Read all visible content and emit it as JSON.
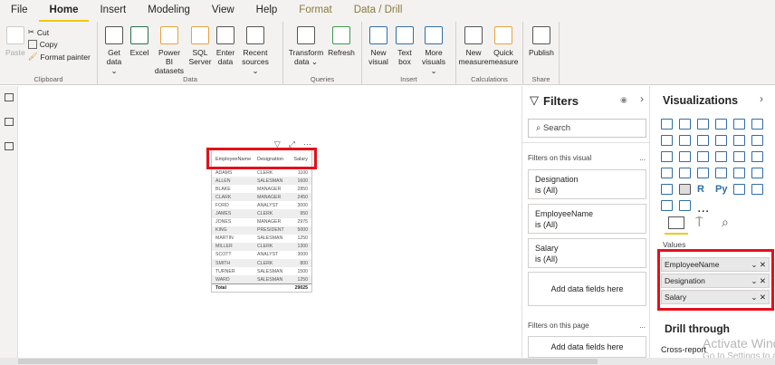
{
  "tabs": [
    "File",
    "Home",
    "Insert",
    "Modeling",
    "View",
    "Help",
    "Format",
    "Data / Drill"
  ],
  "ribbon": {
    "clipboard": {
      "paste": "Paste",
      "cut": "Cut",
      "copy": "Copy",
      "format_painter": "Format painter",
      "label": "Clipboard"
    },
    "data": {
      "buttons": [
        "Get data ⌄",
        "Excel",
        "Power BI datasets",
        "SQL Server",
        "Enter data",
        "Recent sources ⌄"
      ],
      "label": "Data"
    },
    "queries": {
      "buttons": [
        "Transform data ⌄",
        "Refresh"
      ],
      "label": "Queries"
    },
    "insert": {
      "buttons": [
        "New visual",
        "Text box",
        "More visuals ⌄"
      ],
      "label": "Insert"
    },
    "calculations": {
      "buttons": [
        "New measure",
        "Quick measure"
      ],
      "label": "Calculations"
    },
    "share": {
      "buttons": [
        "Publish"
      ],
      "label": "Share"
    }
  },
  "table": {
    "headers": [
      "EmployeeName",
      "Designation",
      "Salary"
    ],
    "rows": [
      [
        "ADAMS",
        "CLERK",
        "1100"
      ],
      [
        "ALLEN",
        "SALESMAN",
        "1600"
      ],
      [
        "BLAKE",
        "MANAGER",
        "2850"
      ],
      [
        "CLARK",
        "MANAGER",
        "2450"
      ],
      [
        "FORD",
        "ANALYST",
        "3000"
      ],
      [
        "JAMES",
        "CLERK",
        "950"
      ],
      [
        "JONES",
        "MANAGER",
        "2975"
      ],
      [
        "KING",
        "PRESIDENT",
        "5000"
      ],
      [
        "MARTIN",
        "SALESMAN",
        "1250"
      ],
      [
        "MILLER",
        "CLERK",
        "1300"
      ],
      [
        "SCOTT",
        "ANALYST",
        "3000"
      ],
      [
        "SMITH",
        "CLERK",
        "800"
      ],
      [
        "TURNER",
        "SALESMAN",
        "1500"
      ],
      [
        "WARD",
        "SALESMAN",
        "1250"
      ]
    ],
    "total_label": "Total",
    "total_value": "29025"
  },
  "filters": {
    "title": "Filters",
    "search_placeholder": "Search",
    "on_visual": "Filters on this visual",
    "more": "...",
    "cards": [
      {
        "name": "Designation",
        "state": "is (All)"
      },
      {
        "name": "EmployeeName",
        "state": "is (All)"
      },
      {
        "name": "Salary",
        "state": "is (All)"
      }
    ],
    "add": "Add data fields here",
    "on_page": "Filters on this page"
  },
  "visualizations": {
    "title": "Visualizations",
    "values_label": "Values",
    "fields": [
      "EmployeeName",
      "Designation",
      "Salary"
    ],
    "drill_through": "Drill through",
    "cross_report": "Cross-report",
    "r": "R",
    "py": "Py",
    "more": "..."
  },
  "watermark": {
    "line1": "Activate Windows",
    "line2": "Go to Settings to activate Windows."
  }
}
